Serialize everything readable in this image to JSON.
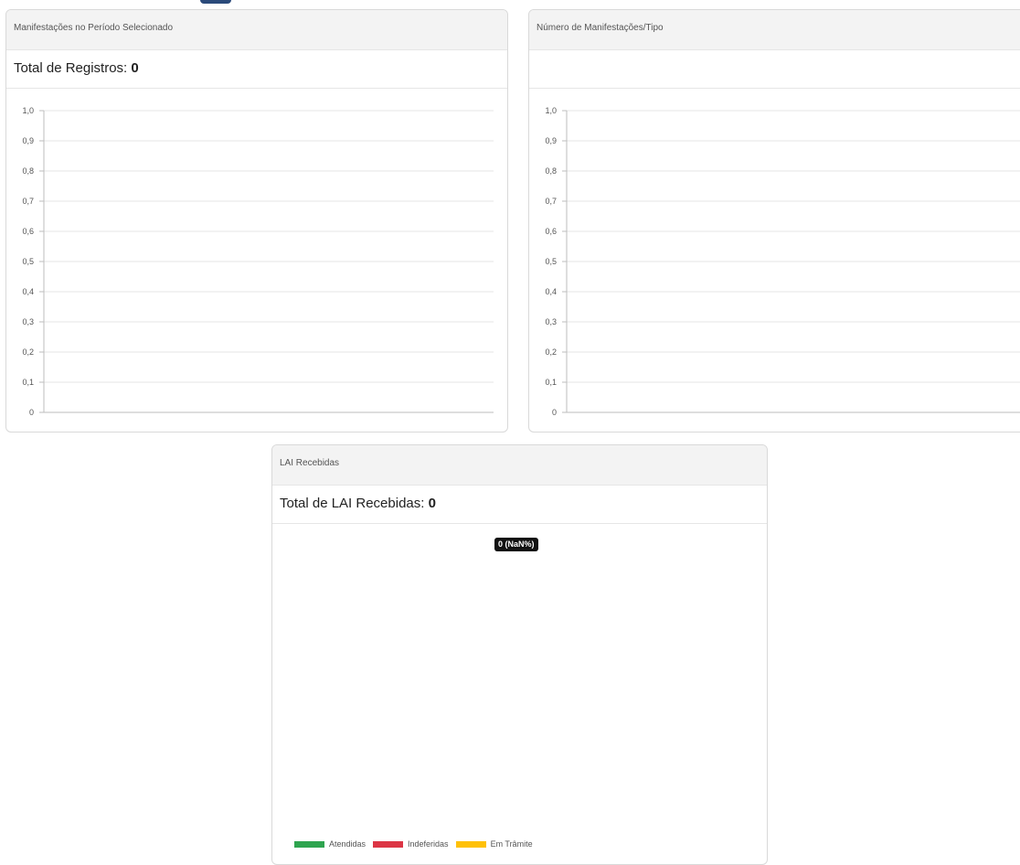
{
  "cards": {
    "manifestacoes": {
      "header": "Manifestações no Período Selecionado",
      "total_label": "Total de Registros: ",
      "total_value": "0"
    },
    "por_tipo": {
      "header": "Número de Manifestações/Tipo"
    },
    "lai": {
      "header": "LAI Recebidas",
      "total_label": "Total de LAI Recebidas: ",
      "total_value": "0",
      "tooltip": "0 (NaN%)",
      "legend": [
        {
          "label": "Atendidas",
          "color": "#2ea44f"
        },
        {
          "label": "Indeferidas",
          "color": "#dc3545"
        },
        {
          "label": "Em Trâmite",
          "color": "#ffc107"
        }
      ]
    }
  },
  "chart_data": [
    {
      "type": "line",
      "title": "",
      "ylim": [
        0,
        1
      ],
      "y_ticks": [
        "1,0",
        "0,9",
        "0,8",
        "0,7",
        "0,6",
        "0,5",
        "0,4",
        "0,3",
        "0,2",
        "0,1",
        "0"
      ],
      "grid": true,
      "series": []
    },
    {
      "type": "bar",
      "title": "",
      "ylim": [
        0,
        1
      ],
      "y_ticks": [
        "1,0",
        "0,9",
        "0,8",
        "0,7",
        "0,6",
        "0,5",
        "0,4",
        "0,3",
        "0,2",
        "0,1",
        "0"
      ],
      "grid": true,
      "series": []
    },
    {
      "type": "pie",
      "title": "",
      "categories": [
        "Atendidas",
        "Indeferidas",
        "Em Trâmite"
      ],
      "values": [
        0,
        0,
        0
      ],
      "legend": "bottom-left"
    }
  ]
}
